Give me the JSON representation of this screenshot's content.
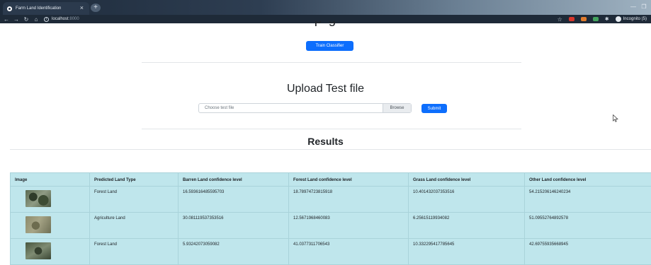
{
  "browser": {
    "tab_title": "Farm Land Identification",
    "address_host": "localhost",
    "address_port": ":8000",
    "incognito_label": "Incognito (5)"
  },
  "page": {
    "train_button": "Train Classifier",
    "upload_title": "Upload Test file",
    "file_placeholder": "Choose test file",
    "browse_label": "Browse",
    "submit_button": "Submit",
    "results_title": "Results"
  },
  "table": {
    "headers": [
      "Image",
      "Predicted Land Type",
      "Barren Land confidence level",
      "Forest Land confidence level",
      "Grass Land confidence level",
      "Other Land confidence level"
    ],
    "rows": [
      {
        "land_type": "Forest Land",
        "barren": "16.593616485595703",
        "forest": "18.78974723815918",
        "grass": "10.401432037353516",
        "other": "54.215206146240234"
      },
      {
        "land_type": "Agriculture Land",
        "barren": "30.081119537353516",
        "forest": "12.5671968460083",
        "grass": "6.25615119934082",
        "other": "51.09552764892578"
      },
      {
        "land_type": "Forest Land",
        "barren": "5.93242073059082",
        "forest": "41.0377311706543",
        "grass": "10.332295417785645",
        "other": "42.69755935668945"
      }
    ]
  },
  "colors": {
    "primary_button": "#0d6efd",
    "table_background": "#bfe6ec"
  }
}
